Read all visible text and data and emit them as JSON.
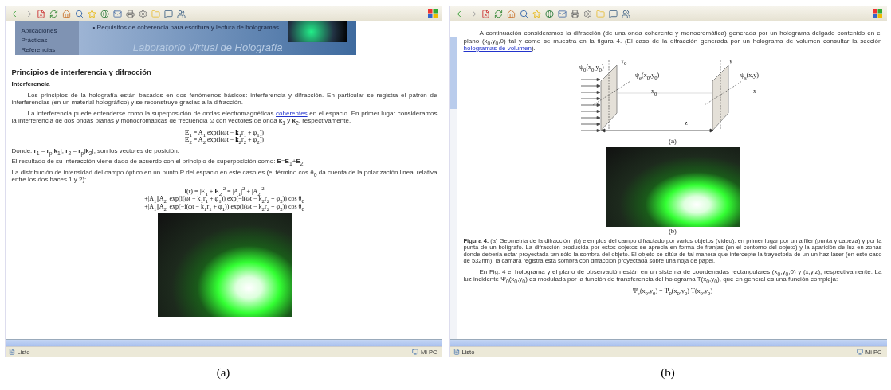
{
  "left_screenshot": {
    "nav_items": [
      "Aplicaciones",
      "Prácticas",
      "Referencias"
    ],
    "banner": {
      "bullet": "• Requisitos de coherencia para escritura y lectura de hologramas",
      "title": "Laboratorio Virtual de Holografía"
    },
    "blocks": [
      {
        "kind": "heading",
        "text": "Principios de interferencia y difracción"
      },
      {
        "kind": "subheading",
        "text": "Interferencia"
      },
      {
        "kind": "paragraph",
        "indent": true,
        "parts": [
          {
            "text": "Los principios de la holografía están basados en dos fenómenos básicos: interferencia y difracción. En particular se registra el patrón de interferencias (en un material holográfico) y se reconstruye gracias a la difracción.",
            "link": false
          }
        ]
      },
      {
        "kind": "paragraph",
        "indent": true,
        "parts": [
          {
            "text": "La interferencia puede entenderse como la superposición de ondas electromagnéticas ",
            "link": false
          },
          {
            "text": "coherentes",
            "link": true
          },
          {
            "text": " en el espacio. En primer lugar consideramos la interferencia de dos ondas planas y monocromáticas de frecuencia ω con vectores de onda **k**$_{1}$ y **k**$_{2}$, respectivamente.",
            "link": false
          }
        ]
      },
      {
        "kind": "equation",
        "lines": [
          "**E**$_{1}$ = A$_{1}$ exp(i(ωt − **k**$_{1}$r$_{1}$ + φ$_{1}$))",
          "**E**$_{2}$ = A$_{2}$ exp(i(ωt − **k**$_{2}$r$_{2}$ + φ$_{2}$))"
        ]
      },
      {
        "kind": "paragraph",
        "indent": false,
        "parts": [
          {
            "text": "Donde: **r**$_{1}$ = **r**$_{p}$|**k**$_{1}$|,  **r**$_{2}$ = **r**$_{p}$|**k**$_{2}$|, son los vectores de posición.",
            "link": false
          }
        ]
      },
      {
        "kind": "paragraph",
        "indent": false,
        "parts": [
          {
            "text": "El resultado de su interacción viene dado de acuerdo con el principio de superposición como: **E**=**E**$_{1}$+**E**$_{2}$",
            "link": false
          }
        ]
      },
      {
        "kind": "paragraph",
        "indent": false,
        "parts": [
          {
            "text": "La distribución de intensidad del campo óptico en un punto P del espacio en este caso es (el término cos θ$_{0}$ da cuenta de la polarización lineal relativa entre los dos haces 1 y 2):",
            "link": false
          }
        ]
      },
      {
        "kind": "equation",
        "lines": [
          "I(r) = |**E**$_{1}$ + **E**$_{2}$|$^{2}$ = |A$_{1}$|$^{2}$ + |A$_{2}$|$^{2}$",
          "+|A$_{1}$||A$_{2}$| exp(i(ωt − k$_{1}$r$_{1}$ + φ$_{1}$)) exp(−i(ωt − k$_{2}$r$_{2}$ + φ$_{2}$)) cos θ$_{0}$",
          "+|A$_{1}$||A$_{2}$| exp(−i(ωt − k$_{1}$r$_{1}$ + φ$_{1}$)) exp(i(ωt − k$_{2}$r$_{2}$ + φ$_{2}$)) cos θ$_{0}$"
        ]
      },
      {
        "kind": "photo"
      }
    ],
    "status_bar": {
      "left": "Listo",
      "right": "Mi PC"
    },
    "caption": "(a)"
  },
  "right_screenshot": {
    "blocks": [
      {
        "kind": "paragraph",
        "indent": true,
        "parts": [
          {
            "text": "A continuación consideramos la difracción (de una onda coherente y monocromática) generada por un holograma delgado contenido en el plano (x$_{0}$,y$_{0}$,0) tal y como se muestra en la figura 4. (El caso de la difracción generada por un holograma de volumen consultar la sección ",
            "link": false
          },
          {
            "text": "hologramas de volumen",
            "link": true
          },
          {
            "text": ").",
            "link": false
          }
        ]
      },
      {
        "kind": "diagram",
        "labels": [
          "ψ$_{0}$(x$_{0}$,y$_{0}$)",
          "y$_{0}$",
          "ψ$_{e}$(x$_{0}$,y$_{0}$)",
          "x$_{0}$",
          "y",
          "ψ$_{s}$(x,y)",
          "x",
          "z"
        ]
      },
      {
        "kind": "figure_label",
        "text": "(a)"
      },
      {
        "kind": "photo"
      },
      {
        "kind": "figure_label",
        "text": "(b)"
      },
      {
        "kind": "figure_caption",
        "text": "**Figura 4.** (a) Geometría de la difracción, (b) ejemplos del campo difractado por varios objetos (vídeo): en primer lugar por un alfiler (punta y cabeza) y por la punta de un bolígrafo. La difracción producida por estos objetos se aprecia en forma de franjas (en el contorno del objeto) y la aparición de luz en zonas donde debería estar proyectada tan sólo la sombra del objeto. El objeto se sitúa de tal manera que intercepte la trayectoria de un un haz láser (en este caso de 532nm), la cámara registra esta sombra con difracción proyectada sobre una hoja de papel."
      },
      {
        "kind": "paragraph",
        "indent": true,
        "parts": [
          {
            "text": "En Fig. 4 el holograma y el plano de observación están en un sistema de coordenadas rectangulares (x$_{0}$,y$_{0}$,0) y (x,y,z), respectivamente. La luz incidente Ψ$_{0}$(x$_{0}$,y$_{0}$) es modulada por la función de transferencia del holograma T(x$_{0}$,y$_{0}$), que en general es una función compleja:",
            "link": false
          }
        ]
      },
      {
        "kind": "equation",
        "lines": [
          "Ψ$_{e}$(x$_{0}$,y$_{0}$) = Ψ$_{0}$(x$_{0}$,y$_{0}$) T(x$_{0}$,y$_{0}$)"
        ]
      }
    ],
    "status_bar": {
      "left": "Listo",
      "right": "Mi PC"
    },
    "caption": "(b)"
  }
}
